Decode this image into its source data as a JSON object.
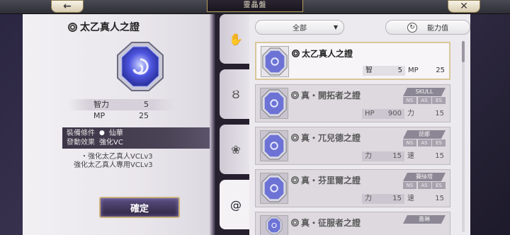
{
  "header": {
    "title": "靈晶盤"
  },
  "selected_item": {
    "name": "太乙真人之證",
    "stats": [
      {
        "label": "智力",
        "value": "5"
      },
      {
        "label": "MP",
        "value": "25"
      }
    ],
    "equip_label": "裝備條件",
    "equip_value": "仙華",
    "effect_label": "發動效果",
    "effect_value": "強化VC",
    "effect_lines": [
      "・強化太乙真人VCLv3",
      "強化太乙真人專用VCLv3"
    ]
  },
  "confirm_label": "確定",
  "filter": {
    "label": "全部"
  },
  "sort": {
    "label": "能力值"
  },
  "cards": [
    {
      "name": "太乙真人之證",
      "tag": "",
      "s1_label": "智",
      "s1_value": "5",
      "s2_label": "MP",
      "s2_value": "25"
    },
    {
      "name": "真・開拓者之證",
      "tag": "SKULL",
      "s1_label": "HP",
      "s1_value": "900",
      "s2_label": "力",
      "s2_value": "15"
    },
    {
      "name": "真・兀兒德之證",
      "tag": "琵娜",
      "s1_label": "力",
      "s1_value": "15",
      "s2_label": "速",
      "s2_value": "15"
    },
    {
      "name": "真・芬里爾之證",
      "tag": "賽絲塔",
      "s1_label": "力",
      "s1_value": "15",
      "s2_label": "速",
      "s2_value": "15"
    },
    {
      "name": "真・征服者之證",
      "tag": "愚琳",
      "s1_label": "",
      "s1_value": "",
      "s2_label": "",
      "s2_value": ""
    }
  ],
  "card_types": [
    "NS",
    "AS",
    "ES"
  ]
}
